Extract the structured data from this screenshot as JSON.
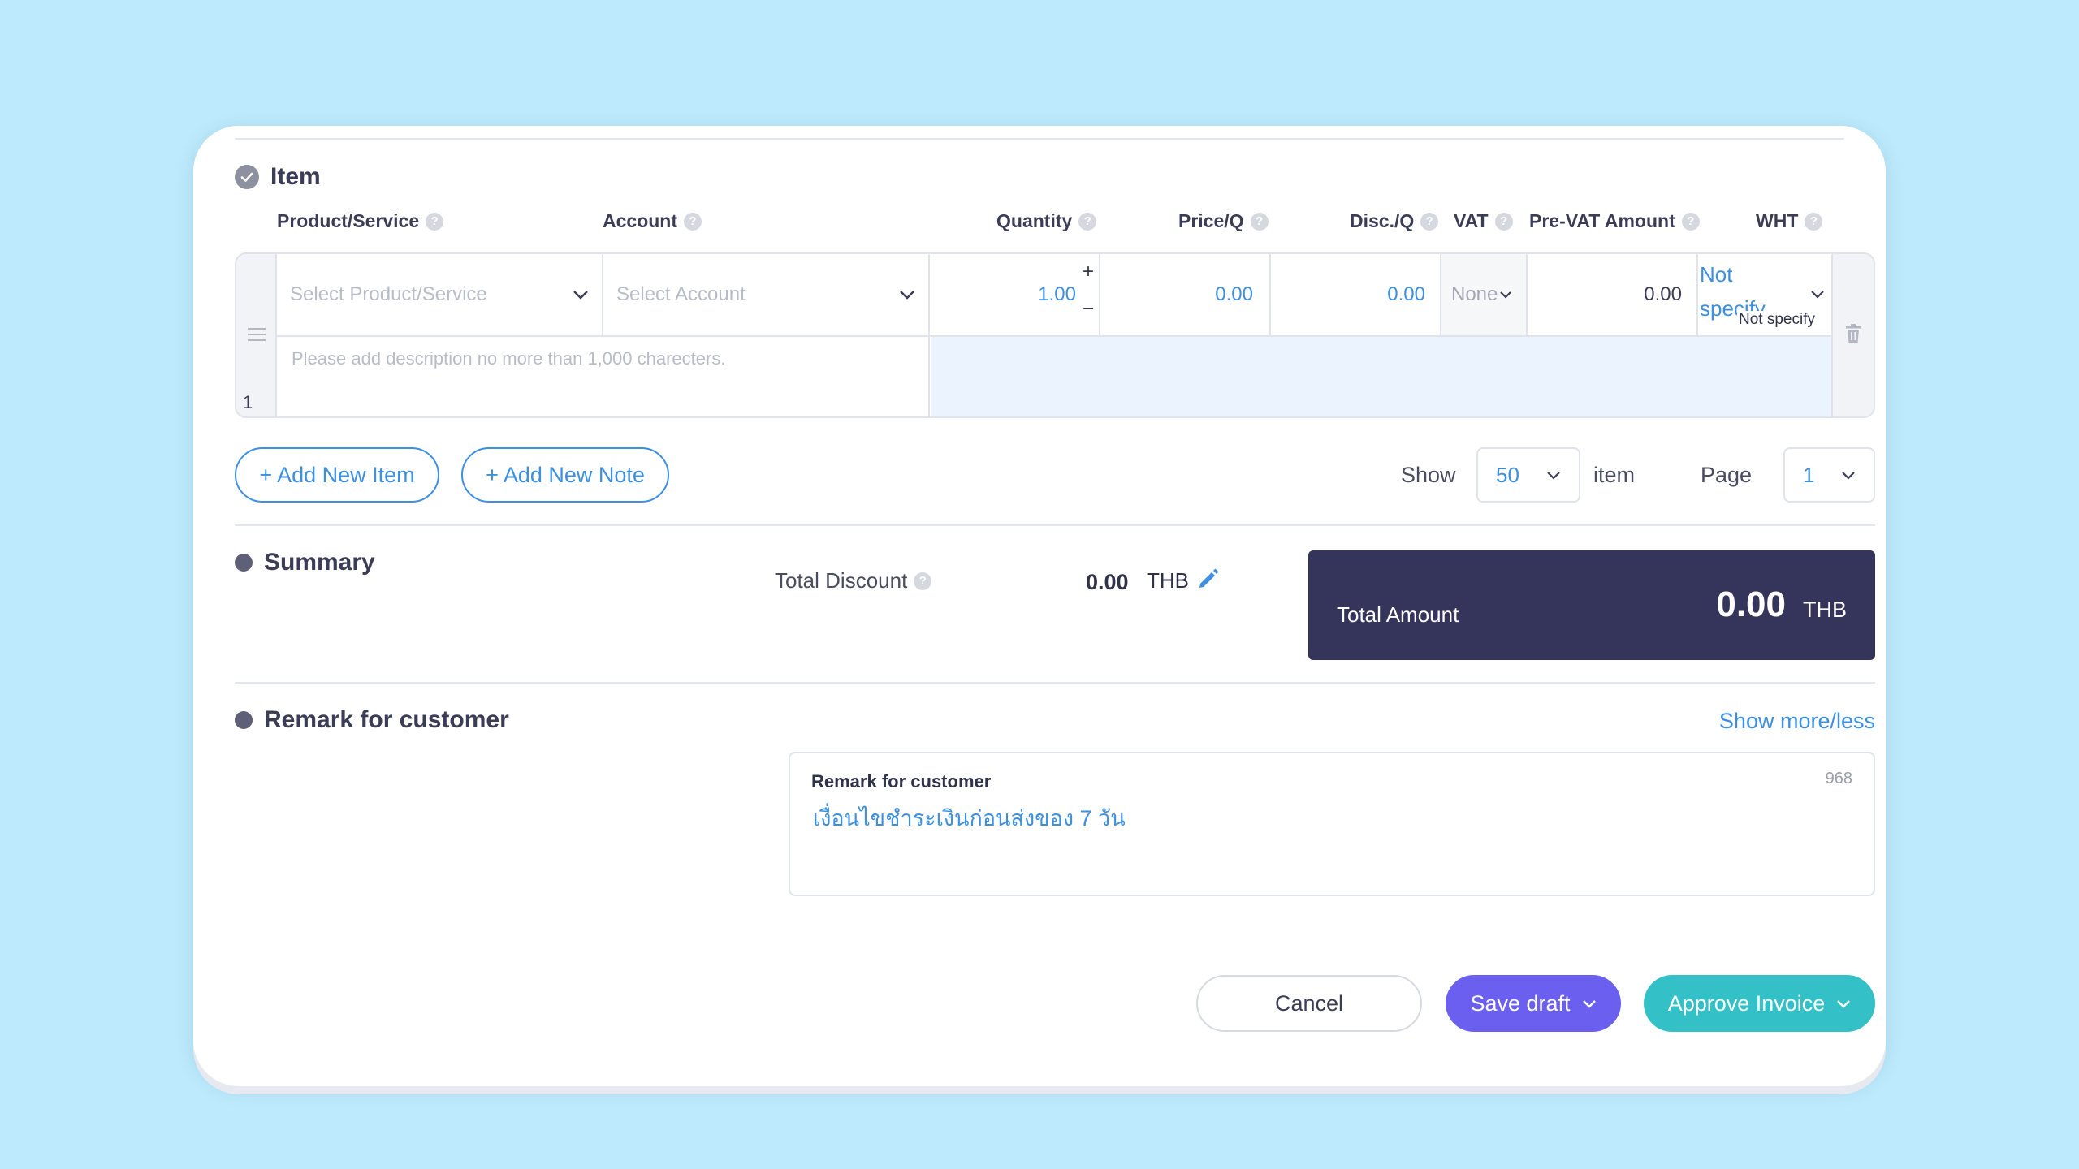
{
  "item_section": {
    "title": "Item",
    "columns": {
      "product": "Product/Service",
      "account": "Account",
      "quantity": "Quantity",
      "price": "Price/Q",
      "discount": "Disc./Q",
      "vat": "VAT",
      "pre_vat": "Pre-VAT Amount",
      "wht": "WHT"
    },
    "row": {
      "number": "1",
      "product_placeholder": "Select Product/Service",
      "account_placeholder": "Select Account",
      "quantity": "1.00",
      "plus": "+",
      "minus": "−",
      "price": "0.00",
      "discount": "0.00",
      "vat": "None",
      "pre_vat": "0.00",
      "wht_line1": "Not",
      "wht_line2": "specify",
      "wht_tooltip": "Not specify",
      "description_placeholder": "Please add description no more than 1,000 charecters."
    },
    "help_mark": "?"
  },
  "actions": {
    "add_item": "+ Add New Item",
    "add_note": "+ Add New Note"
  },
  "pagination": {
    "show_label": "Show",
    "page_size": "50",
    "item_label": "item",
    "page_label": "Page",
    "page": "1"
  },
  "summary": {
    "title": "Summary",
    "total_discount_label": "Total Discount",
    "total_discount_value": "0.00",
    "currency": "THB",
    "total_amount_label": "Total Amount",
    "total_amount_value": "0.00"
  },
  "remark": {
    "title": "Remark for customer",
    "toggle": "Show more/less",
    "box_label": "Remark for customer",
    "counter": "968",
    "text": "เงื่อนไขชำระเงินก่อนส่งของ 7 วัน"
  },
  "footer": {
    "cancel": "Cancel",
    "save_draft": "Save draft",
    "approve": "Approve Invoice"
  },
  "colors": {
    "background": "#bdeafc",
    "accent_blue": "#3d8fe0",
    "total_box": "#35345a",
    "save_draft": "#6b5ff0",
    "approve": "#33c0c6"
  }
}
